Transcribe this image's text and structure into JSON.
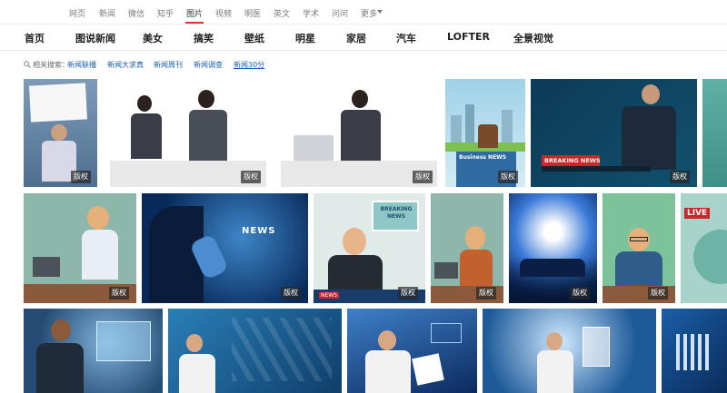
{
  "topnav": {
    "items": [
      "网页",
      "新闻",
      "微信",
      "知乎",
      "图片",
      "视频",
      "明医",
      "英文",
      "学术",
      "问问",
      "更多"
    ],
    "active_index": 4,
    "accent": "#e0342a"
  },
  "categories": [
    "首页",
    "图说新闻",
    "美女",
    "搞笑",
    "壁纸",
    "明星",
    "家居",
    "汽车",
    "LOFTER",
    "全景视觉"
  ],
  "related": {
    "label": "相关搜索：",
    "links": [
      "新闻联播",
      "新闻大求真",
      "新闻周刊",
      "新闻调查",
      "新闻30分"
    ]
  },
  "badge_label": "版权",
  "tile_texts": {
    "breaking_news_sign": "Business NEWS",
    "breaking_news_bar": "BREAKING NEWS",
    "news_screen": "NEWS",
    "breaking_board": "BREAKING NEWS",
    "news_ticker": "NEWS",
    "live_tag": "LIVE"
  },
  "icons": {
    "search": "search-icon",
    "more": "chevron-down-icon"
  }
}
